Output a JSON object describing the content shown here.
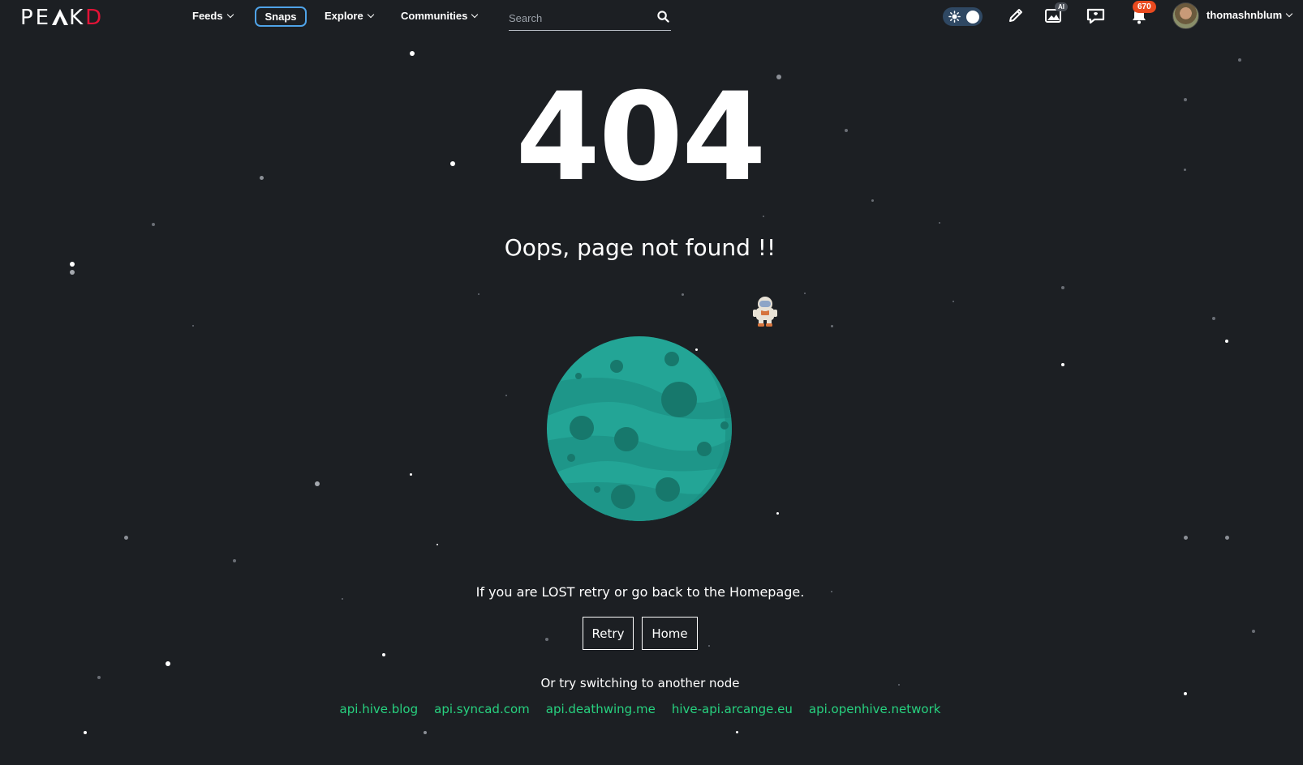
{
  "header": {
    "logo": {
      "part1": "PE",
      "part2": "K",
      "part3": "D"
    },
    "nav": [
      {
        "label": "Feeds"
      },
      {
        "label": "Snaps"
      },
      {
        "label": "Explore"
      },
      {
        "label": "Communities"
      }
    ],
    "search": {
      "placeholder": "Search",
      "value": ""
    },
    "theme_toggle": {
      "state": "dark"
    },
    "ai_badge": "AI",
    "notification_count": "670",
    "username": "thomashnblum",
    "accent_color": "#4fa3e8"
  },
  "main": {
    "error_code": "404",
    "headline": "Oops, page not found !!",
    "hint": "If you are LOST retry or go back to the Homepage.",
    "buttons": {
      "retry": "Retry",
      "home": "Home"
    },
    "switch_text": "Or try switching to another node",
    "nodes": [
      "api.hive.blog",
      "api.syncad.com",
      "api.deathwing.me",
      "hive-api.arcange.eu",
      "api.openhive.network"
    ],
    "node_link_color": "#27d17f"
  }
}
